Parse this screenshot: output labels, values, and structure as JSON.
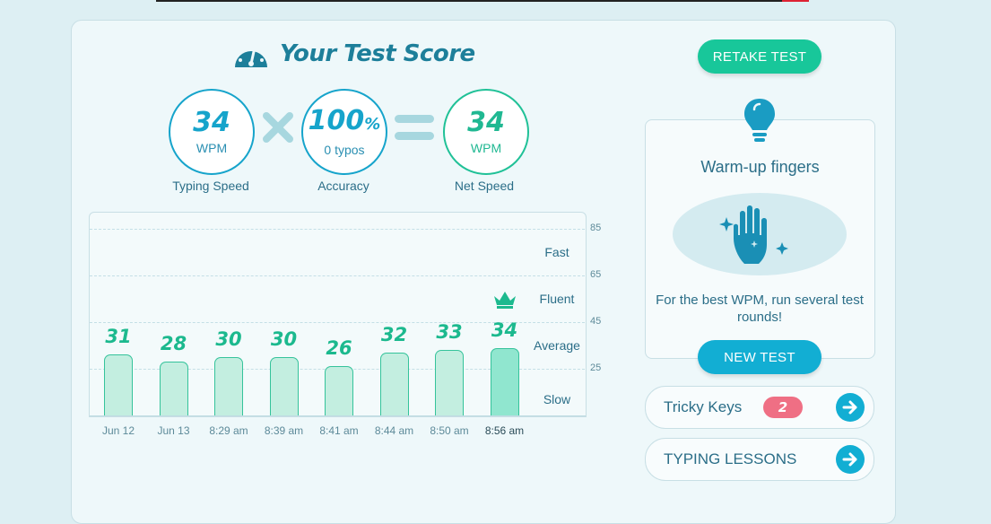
{
  "title": "Your Test Score",
  "stats": {
    "speed": {
      "value": "34",
      "unit": "WPM",
      "label": "Typing Speed"
    },
    "accuracy": {
      "value": "100",
      "pct": "%",
      "sub": "0 typos",
      "label": "Accuracy"
    },
    "net": {
      "value": "34",
      "unit": "WPM",
      "label": "Net Speed"
    }
  },
  "buttons": {
    "retake": "RETAKE TEST",
    "new_test": "NEW TEST"
  },
  "warmup": {
    "title": "Warm-up fingers",
    "text": "For the best WPM, run several test rounds!"
  },
  "tricky_keys": {
    "label": "Tricky Keys",
    "count": "2"
  },
  "typing_lessons": {
    "label": "TYPING LESSONS"
  },
  "colors": {
    "accent": "#16a4cb",
    "green": "#20c197",
    "badge": "#ef6f84"
  },
  "chart_data": {
    "type": "bar",
    "categories": [
      "Jun 12",
      "Jun 13",
      "8:29 am",
      "8:39 am",
      "8:41 am",
      "8:44 am",
      "8:50 am",
      "8:56 am"
    ],
    "values": [
      31,
      28,
      30,
      30,
      26,
      32,
      33,
      34
    ],
    "y_ticks": [
      "85",
      "65",
      "45",
      "25"
    ],
    "zones": [
      "Fast",
      "Fluent",
      "Average",
      "Slow"
    ],
    "ylim": [
      0,
      85
    ],
    "highlight": "8:56 am",
    "grid": true
  }
}
